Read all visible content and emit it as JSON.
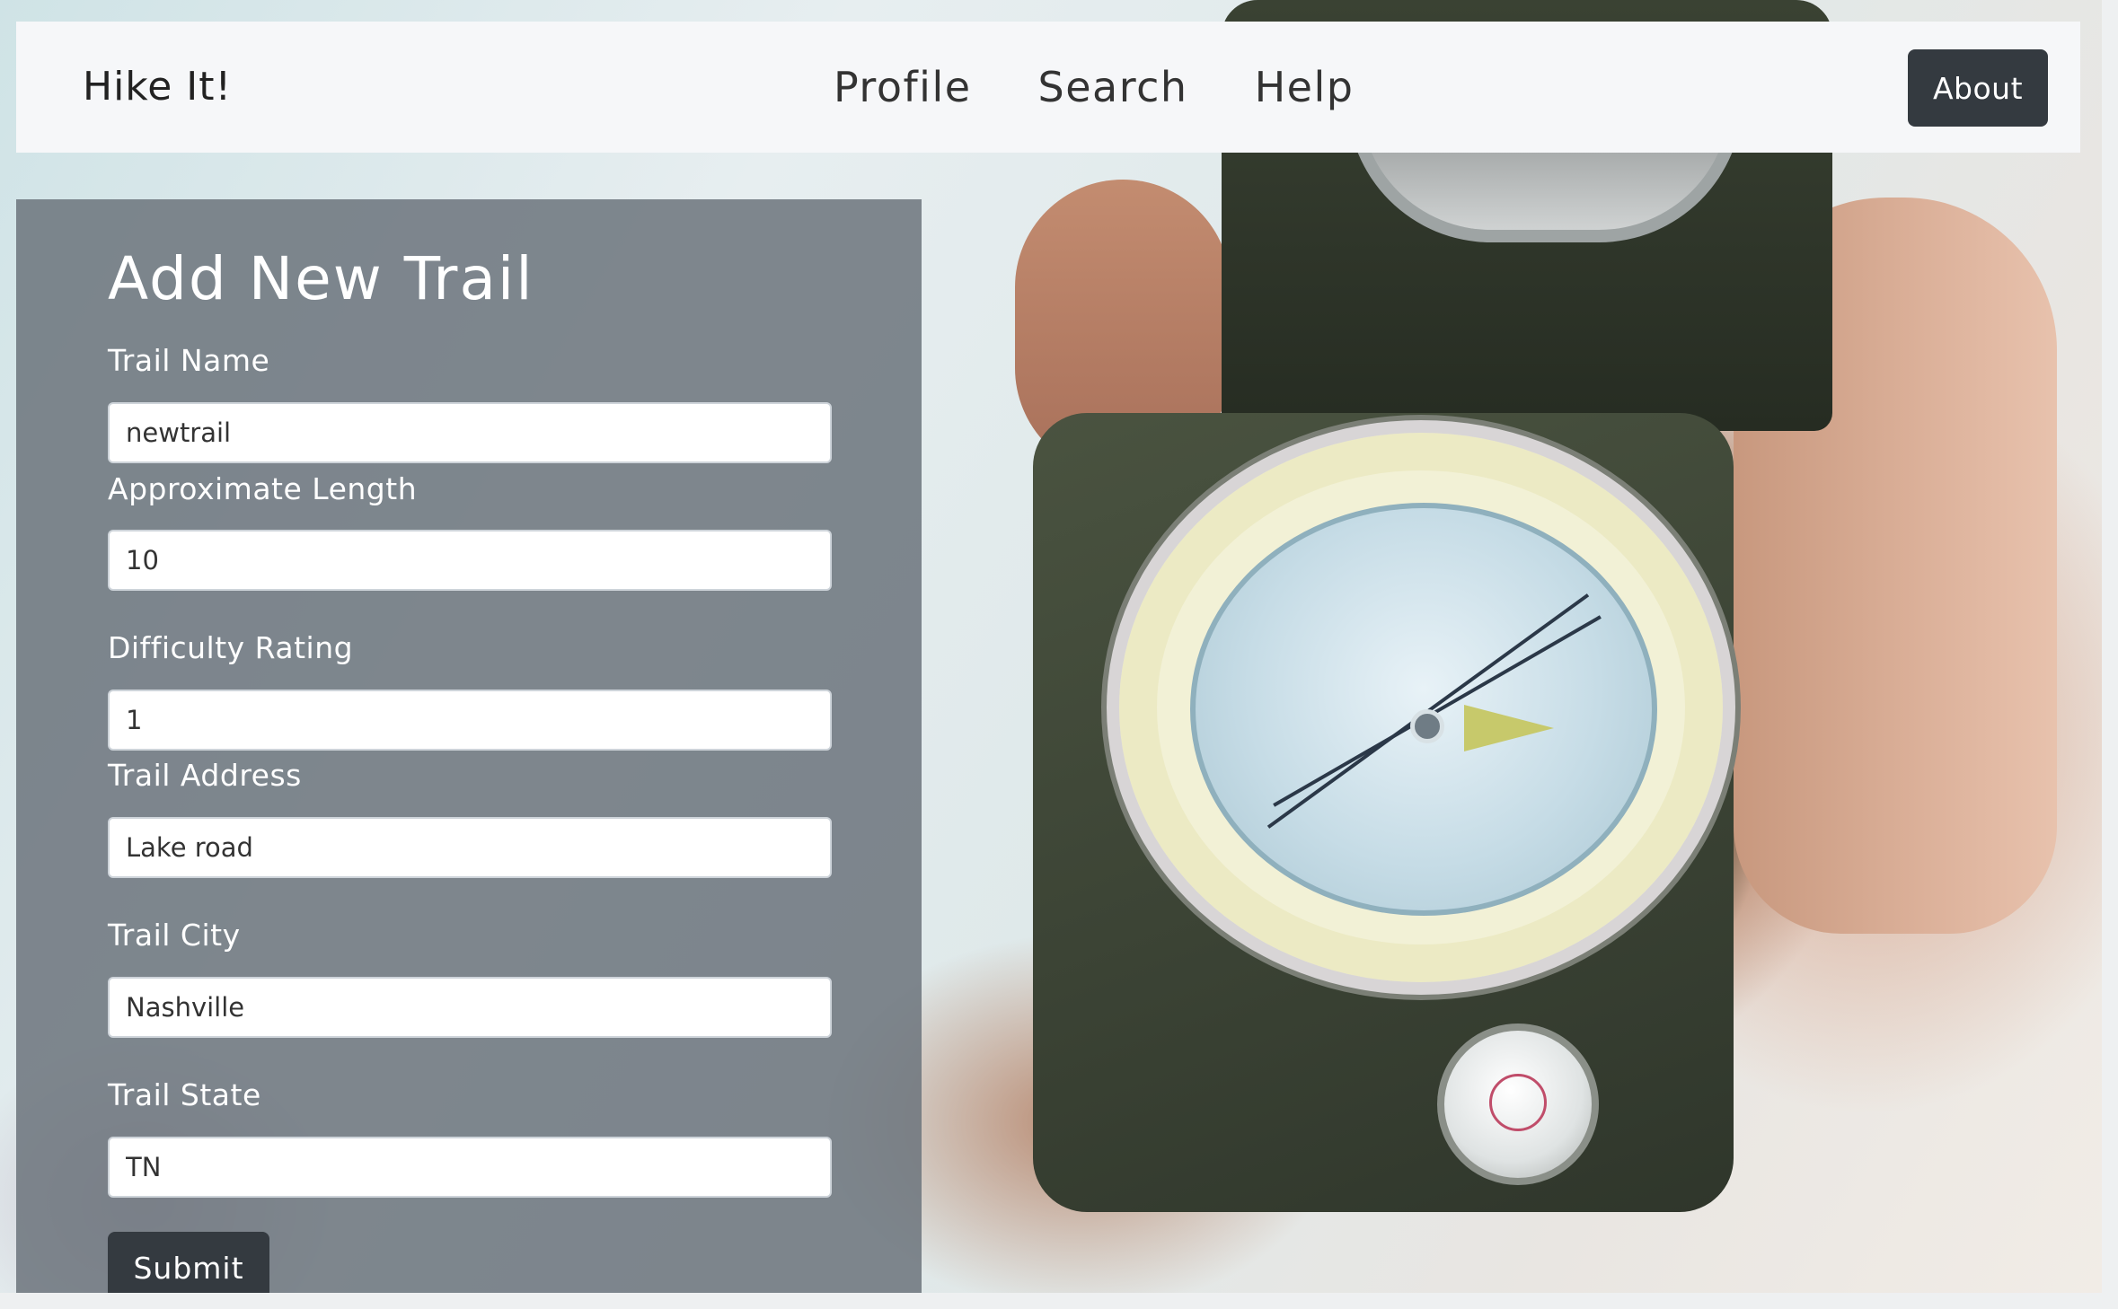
{
  "navbar": {
    "brand": "Hike It!",
    "links": [
      "Profile",
      "Search",
      "Help"
    ],
    "about_label": "About"
  },
  "form": {
    "title": "Add New Trail",
    "fields": [
      {
        "label": "Trail Name",
        "value": "newtrail"
      },
      {
        "label": "Approximate Length",
        "value": "10"
      },
      {
        "label": "Difficulty Rating",
        "value": "1"
      },
      {
        "label": "Trail Address",
        "value": "Lake road"
      },
      {
        "label": "Trail City",
        "value": "Nashville"
      },
      {
        "label": "Trail State",
        "value": "TN"
      }
    ],
    "submit_label": "Submit"
  },
  "colors": {
    "navbar_bg": "#f6f7f9",
    "button_dark": "#343a40",
    "panel_overlay": "#6c757d"
  },
  "background": {
    "image": "hand holding compass over map"
  }
}
